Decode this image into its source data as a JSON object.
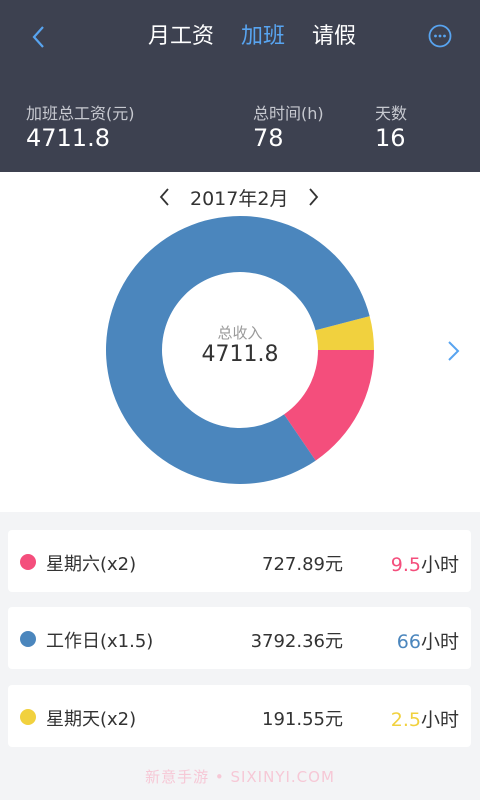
{
  "header": {
    "tabs": [
      {
        "label": "月工资",
        "active": false
      },
      {
        "label": "加班",
        "active": true
      },
      {
        "label": "请假",
        "active": false
      }
    ],
    "stats": [
      {
        "label": "加班总工资(元)",
        "value": "4711.8"
      },
      {
        "label": "总时间(h)",
        "value": "78"
      },
      {
        "label": "天数",
        "value": "16"
      }
    ]
  },
  "chart": {
    "month": "2017年2月",
    "center_label": "总收入",
    "center_value": "4711.8"
  },
  "chart_data": {
    "type": "pie",
    "categories": [
      "星期六(x2)",
      "工作日(x1.5)",
      "星期天(x2)"
    ],
    "values": [
      727.89,
      3792.36,
      191.55
    ],
    "colors": [
      "#f44e7c",
      "#4b86bd",
      "#f1d13e"
    ],
    "start_angle_deg": 60
  },
  "items": [
    {
      "name": "星期六(x2)",
      "amount": "727.89元",
      "hours": "9.5",
      "unit": "小时",
      "color": "#f44e7c"
    },
    {
      "name": "工作日(x1.5)",
      "amount": "3792.36元",
      "hours": "66",
      "unit": "小时",
      "color": "#4b86bd"
    },
    {
      "name": "星期天(x2)",
      "amount": "191.55元",
      "hours": "2.5",
      "unit": "小时",
      "color": "#f1d13e"
    }
  ],
  "watermark": "新意手游 • SIXINYI.COM",
  "icons": {
    "back": "chevron-left-icon",
    "more": "more-dots-icon",
    "prev": "chevron-left-icon",
    "next": "chevron-right-icon"
  }
}
